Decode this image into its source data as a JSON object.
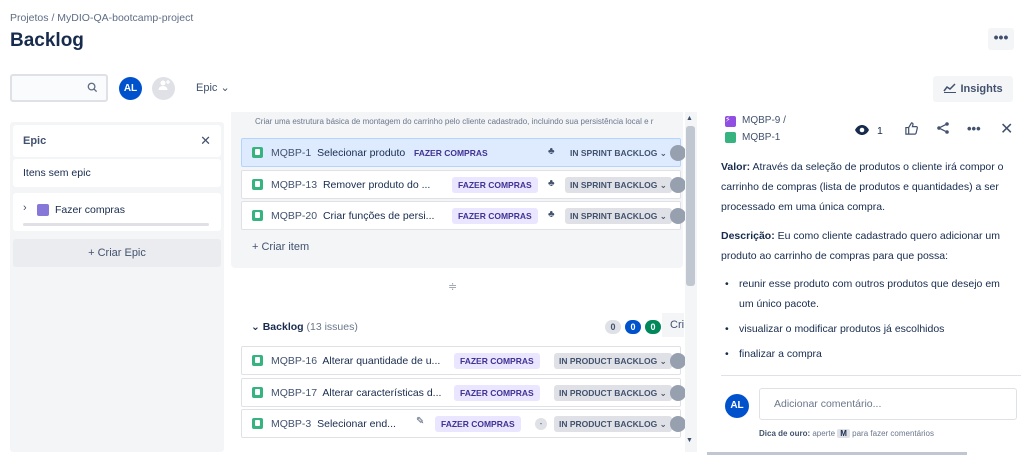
{
  "breadcrumb": {
    "projects": "Projetos",
    "sep": "/",
    "project": "MyDIO-QA-bootcamp-project"
  },
  "page": {
    "title": "Backlog",
    "more": "•••"
  },
  "toolbar": {
    "search_icon": "search-icon",
    "avatar_initials": "AL",
    "add_people_icon": "add-person-icon",
    "epic_filter": "Epic ⌄",
    "insights": "Insights"
  },
  "epic_panel": {
    "title": "Epic",
    "close": "✕",
    "no_epic": "Itens sem epic",
    "epic_item": {
      "chevron": "›",
      "name": "Fazer compras",
      "color": "#8777d9"
    },
    "create_epic": "+ Criar Epic"
  },
  "sprint": {
    "description": "Criar uma estrutura básica de montagem do carrinho pelo cliente cadastrado, incluindo sua persistência local e r",
    "rows": [
      {
        "key": "MQBP-1",
        "summary": "Selecionar produto",
        "epic": "FAZER COMPRAS",
        "status": "IN SPRINT BACKLOG ⌄"
      },
      {
        "key": "MQBP-13",
        "summary": "Remover produto do ...",
        "epic": "FAZER COMPRAS",
        "status": "IN SPRINT BACKLOG ⌄"
      },
      {
        "key": "MQBP-20",
        "summary": "Criar funções de persi...",
        "epic": "FAZER COMPRAS",
        "status": "IN SPRINT BACKLOG ⌄"
      }
    ],
    "create_item": "+ Criar item"
  },
  "backlog": {
    "title": "Backlog",
    "count": "(13 issues)",
    "pills": [
      {
        "value": "0",
        "bg": "#dfe1e6",
        "fg": "#42526e"
      },
      {
        "value": "0",
        "bg": "#0052cc",
        "fg": "#ffffff"
      },
      {
        "value": "0",
        "bg": "#00875a",
        "fg": "#ffffff"
      }
    ],
    "create_sprint": "Cri",
    "rows": [
      {
        "key": "MQBP-16",
        "summary": "Alterar quantidade de u...",
        "epic": "FAZER COMPRAS",
        "status": "IN PRODUCT BACKLOG ⌄"
      },
      {
        "key": "MQBP-17",
        "summary": "Alterar características d...",
        "epic": "FAZER COMPRAS",
        "status": "IN PRODUCT BACKLOG ⌄"
      },
      {
        "key": "MQBP-3",
        "summary": "Selecionar end...",
        "epic": "FAZER COMPRAS",
        "status": "IN PRODUCT BACKLOG ⌄"
      }
    ]
  },
  "detail": {
    "parent_key": "MQBP-9",
    "sep": "/",
    "issue_key": "MQBP-1",
    "watchers": "1",
    "valor_label": "Valor:",
    "valor_text": " Através da seleção de produtos o cliente irá compor o carrinho de compras (lista de produtos e quantidades) a ser processado em uma única compra.",
    "descricao_label": "Descrição:",
    "descricao_text": " Eu como cliente cadastrado quero adicionar um produto ao carrinho de compras para que possa:",
    "bullets": [
      "reunir esse produto com outros produtos que desejo em um único pacote.",
      "visualizar o modificar produtos já escolhidos",
      "finalizar a compra"
    ],
    "comment_avatar": "AL",
    "comment_placeholder": "Adicionar comentário...",
    "tip_bold": "Dica de ouro:",
    "tip_pre": " aperte ",
    "tip_key": "M",
    "tip_post": " para fazer comentários"
  },
  "colors": {
    "accent": "#0052cc",
    "story": "#36b37e",
    "epic_lozenge_bg": "#eae6ff",
    "epic_lozenge_fg": "#403294"
  }
}
